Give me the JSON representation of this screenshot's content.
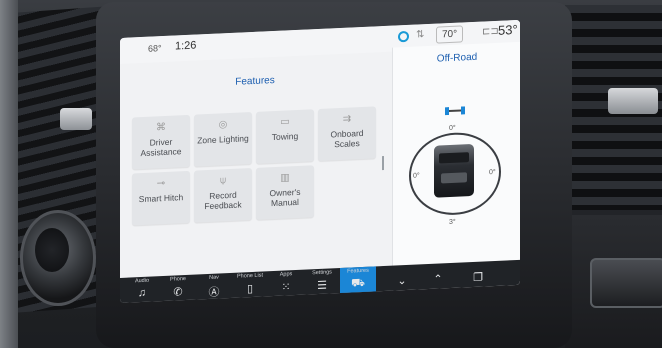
{
  "status_bar": {
    "outside_temp_left": "68°",
    "time": "1:26",
    "climate_temp": "70°",
    "outside_temp_right": "53°"
  },
  "features_panel": {
    "title": "Features",
    "buttons": [
      {
        "label": "Driver Assistance",
        "icon": "driver-assist-icon"
      },
      {
        "label": "Zone Lighting",
        "icon": "zone-lighting-icon"
      },
      {
        "label": "Towing",
        "icon": "towing-icon"
      },
      {
        "label": "Onboard Scales",
        "icon": "scales-icon"
      },
      {
        "label": "Smart Hitch",
        "icon": "hitch-icon"
      },
      {
        "label": "Record Feedback",
        "icon": "microphone-icon"
      },
      {
        "label": "Owner's Manual",
        "icon": "manual-icon"
      }
    ]
  },
  "offroad_panel": {
    "title": "Off-Road",
    "pitch_top": "0°",
    "roll_left": "0°",
    "roll_right": "0°",
    "pitch_bottom": "3°"
  },
  "nav_bar": {
    "items": [
      {
        "label": "Audio",
        "icon": "music-note-icon"
      },
      {
        "label": "Phone",
        "icon": "phone-icon"
      },
      {
        "label": "Nav",
        "icon": "navigation-icon"
      },
      {
        "label": "Phone List",
        "icon": "phone-list-icon"
      },
      {
        "label": "Apps",
        "icon": "apps-grid-icon"
      },
      {
        "label": "Settings",
        "icon": "settings-sliders-icon"
      },
      {
        "label": "Features",
        "icon": "features-car-icon",
        "active": true
      }
    ]
  },
  "colors": {
    "accent": "#1b86d6",
    "title_blue": "#1d5fb0",
    "nav_background": "#202327"
  }
}
